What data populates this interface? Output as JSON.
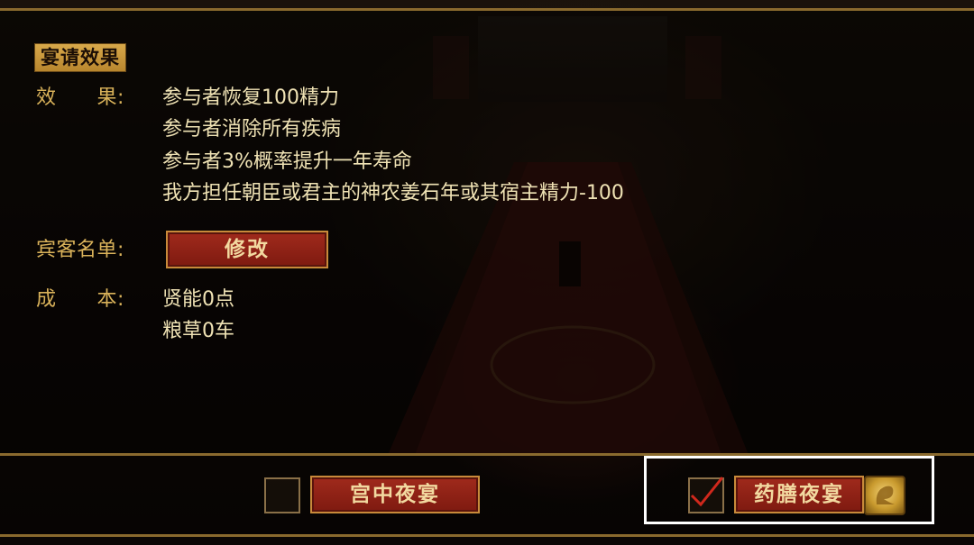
{
  "section_title": "宴请效果",
  "effect": {
    "label": "效　　果:",
    "lines": [
      "参与者恢复100精力",
      "参与者消除所有疾病",
      "参与者3%概率提升一年寿命",
      "我方担任朝臣或君主的神农姜石年或其宿主精力-100"
    ]
  },
  "guest_list": {
    "label": "宾客名单:",
    "modify_button": "修改"
  },
  "cost": {
    "label": "成　　本:",
    "lines": [
      "贤能0点",
      "粮草0车"
    ]
  },
  "banquet_options": [
    {
      "label": "宫中夜宴",
      "checked": false
    },
    {
      "label": "药膳夜宴",
      "checked": true
    }
  ],
  "icons": {
    "check": "check-icon",
    "gold_dragon": "gold-dragon-icon"
  },
  "colors": {
    "gold": "#d9b25a",
    "text": "#efe2b4",
    "button_red": "#8e2014",
    "check_red": "#d0281c"
  }
}
